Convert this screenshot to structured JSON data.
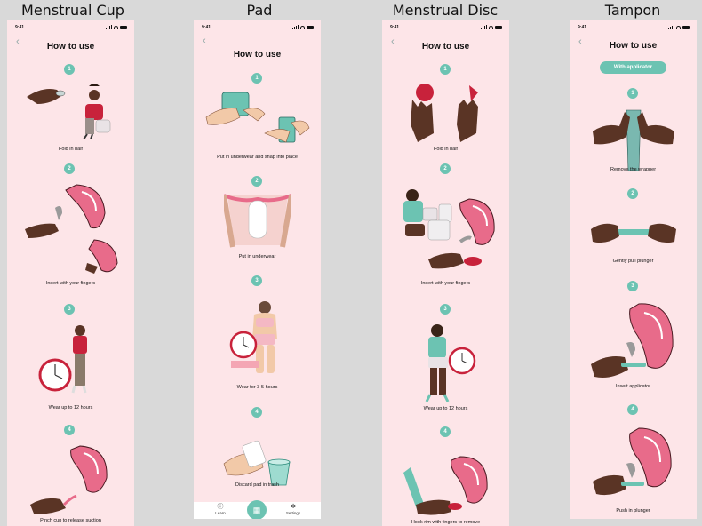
{
  "columns": {
    "cup": "Menstrual Cup",
    "pad": "Pad",
    "disc": "Menstrual Disc",
    "tampon": "Tampon"
  },
  "status_time": "9:41",
  "back_icon": "‹",
  "screen_title": "How to use",
  "cup_steps": [
    {
      "num": "1",
      "caption": "Fold in half"
    },
    {
      "num": "2",
      "caption": "Insert with your fingers"
    },
    {
      "num": "3",
      "caption": "Wear up to 12 hours"
    },
    {
      "num": "4",
      "caption": "Pinch cup to release suction"
    }
  ],
  "pad_steps": [
    {
      "num": "1",
      "caption": "Put in underwear and snap into place"
    },
    {
      "num": "2",
      "caption": "Put in underwear"
    },
    {
      "num": "3",
      "caption": "Wear for 3-5 hours"
    },
    {
      "num": "4",
      "caption": "Discard pad in trash"
    }
  ],
  "disc_steps": [
    {
      "num": "1",
      "caption": "Fold in half"
    },
    {
      "num": "2",
      "caption": "Insert with your fingers"
    },
    {
      "num": "3",
      "caption": "Wear up to 12 hours"
    },
    {
      "num": "4",
      "caption": "Hook rim with fingers to remove"
    }
  ],
  "tampon_toggle": "With applicator",
  "tampon_steps": [
    {
      "num": "1",
      "caption": "Remove the wrapper"
    },
    {
      "num": "2",
      "caption": "Gently pull plunger"
    },
    {
      "num": "3",
      "caption": "Insert applicator"
    },
    {
      "num": "4",
      "caption": "Push in plunger"
    }
  ],
  "tabbar": {
    "learn": "Learn",
    "settings": "Settings",
    "learn_icon": "ⓘ",
    "calendar_icon": "▦",
    "settings_icon": "✲"
  },
  "colors": {
    "screen_bg": "#fde5e8",
    "accent": "#6cc3b2",
    "pink": "#e86b8a",
    "red": "#c8223b",
    "skin_dark": "#5a3425",
    "skin_light": "#f2c9a8"
  }
}
